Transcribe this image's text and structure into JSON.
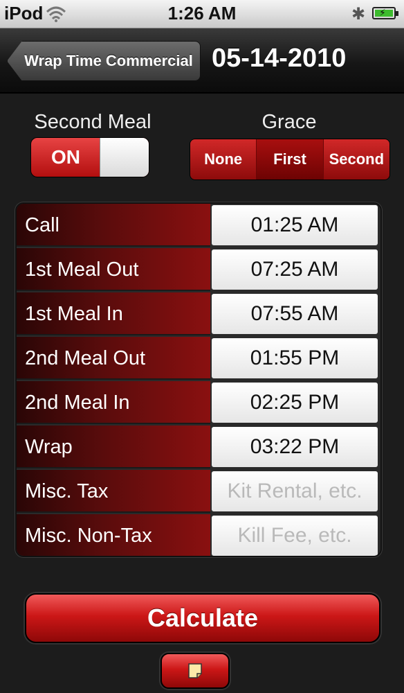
{
  "status_bar": {
    "carrier": "iPod",
    "time": "1:26 AM"
  },
  "nav": {
    "back_label": "Wrap Time Commercial",
    "title": "05-14-2010"
  },
  "options": {
    "second_meal_label": "Second Meal",
    "second_meal_state": "ON",
    "grace_label": "Grace",
    "grace_segments": [
      "None",
      "First",
      "Second"
    ],
    "grace_selected": "First"
  },
  "rows": [
    {
      "label": "Call",
      "value": "01:25 AM",
      "placeholder": ""
    },
    {
      "label": "1st Meal Out",
      "value": "07:25 AM",
      "placeholder": ""
    },
    {
      "label": "1st Meal In",
      "value": "07:55 AM",
      "placeholder": ""
    },
    {
      "label": "2nd Meal Out",
      "value": "01:55 PM",
      "placeholder": ""
    },
    {
      "label": "2nd Meal In",
      "value": "02:25 PM",
      "placeholder": ""
    },
    {
      "label": "Wrap",
      "value": "03:22 PM",
      "placeholder": ""
    },
    {
      "label": "Misc. Tax",
      "value": "",
      "placeholder": "Kit Rental, etc."
    },
    {
      "label": "Misc. Non-Tax",
      "value": "",
      "placeholder": "Kill Fee, etc."
    }
  ],
  "buttons": {
    "calculate": "Calculate",
    "notes_icon": "note-icon"
  },
  "colors": {
    "accent_red": "#cc1717",
    "switch_on": "#e74343"
  }
}
